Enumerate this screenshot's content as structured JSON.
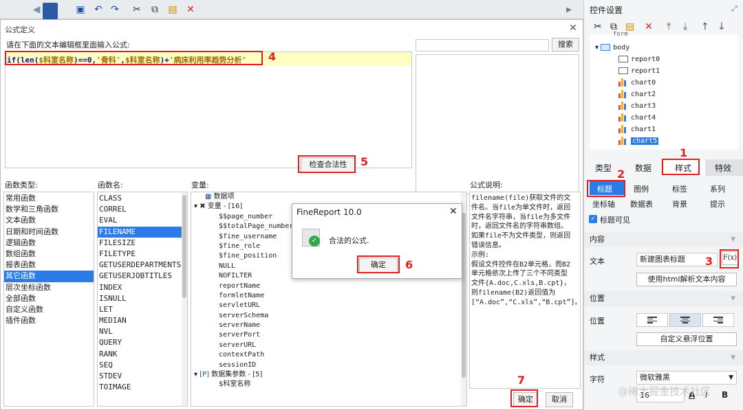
{
  "formula_dialog": {
    "title": "公式定义",
    "hint": "请在下面的文本编辑框里面输入公式:",
    "formula": {
      "p1": "if(",
      "p2": "len(",
      "p3": "$科室名称",
      "p4": ")==0,",
      "p5": "'骨科'",
      "p6": ",",
      "p7": "$科室名称",
      "p8": ")+",
      "p9": "'病床利用率趋势分析'"
    },
    "search_label": "搜索",
    "check_label": "检查合法性",
    "columns": {
      "func_type": "函数类型:",
      "func_name": "函数名:",
      "variables": "变量:",
      "description": "公式说明:"
    },
    "func_types": [
      "常用函数",
      "数学和三角函数",
      "文本函数",
      "日期和时间函数",
      "逻辑函数",
      "数组函数",
      "报表函数",
      "其它函数",
      "层次坐标函数",
      "全部函数",
      "自定义函数",
      "插件函数"
    ],
    "func_names": [
      "CLASS",
      "CORREL",
      "EVAL",
      "FILENAME",
      "FILESIZE",
      "FILETYPE",
      "GETUSERDEPARTMENTS",
      "GETUSERJOBTITLES",
      "INDEX",
      "ISNULL",
      "LET",
      "MEDIAN",
      "NVL",
      "QUERY",
      "RANK",
      "SEQ",
      "STDEV",
      "TOIMAGE"
    ],
    "variables": {
      "data_item": "数据项",
      "var_group": "变量 - [16]",
      "var_items": [
        "$$page_number",
        "$$totalPage_number",
        "$fine_username",
        "$fine_role",
        "$fine_position",
        "NULL",
        "NOFILTER",
        "reportName",
        "formletName",
        "servletURL",
        "serverSchema",
        "serverName",
        "serverPort",
        "serverURL",
        "contextPath",
        "sessionID"
      ],
      "param_group": "数据集参数 - [5]",
      "param_items": [
        "$科室名称"
      ]
    },
    "description": "filename(file)获取文件的文件名。当file为单文件时，返回文件名字符串，当file为多文件时，返回文件名的字符串数组。如果file不为文件类型，则返回错误信息。\n示例:\n假设文件控件在B2单元格，而B2单元格依次上传了三个不同类型文件{A.doc,C.xls,B.cpt}，则filename(B2)返回值为[“A.doc”,“C.xls”,“B.cpt”]。",
    "ok_label": "确定",
    "cancel_label": "取消"
  },
  "message_box": {
    "title": "FineReport 10.0",
    "text": "合法的公式.",
    "ok_label": "确定"
  },
  "panel": {
    "title": "控件设置",
    "tree_cut_label": "form",
    "tree": [
      "body",
      "report0",
      "report1",
      "chart0",
      "chart2",
      "chart3",
      "chart4",
      "chart1",
      "chart5"
    ],
    "tabs": [
      "类型",
      "数据",
      "样式",
      "特效"
    ],
    "subtabs": [
      "标题",
      "图例",
      "标签",
      "系列",
      "坐标轴",
      "数据表",
      "背景",
      "提示"
    ],
    "title_visible": "标题可见",
    "content_section": "内容",
    "text_label": "文本",
    "text_value": "新建图表标题",
    "fx_label": "F(x)",
    "html_parse_label": "使用html解析文本内容",
    "position_section": "位置",
    "position_label": "位置",
    "custom_float_label": "自定义悬浮位置",
    "style_section": "样式",
    "font_label": "字符",
    "font_value": "微软雅黑",
    "font_size": "16"
  },
  "annotations": [
    "1",
    "2",
    "3",
    "4",
    "5",
    "6",
    "7"
  ],
  "watermark": "@稀土掘金技术社区",
  "colors": {
    "accent": "#2b7ce9",
    "annotation": "#e02020",
    "selection": "#2b7ce9"
  }
}
